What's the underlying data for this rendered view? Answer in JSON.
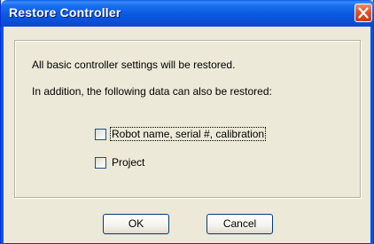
{
  "window": {
    "title": "Restore Controller"
  },
  "message": {
    "line1": "All basic controller settings will be restored.",
    "line2": "In addition, the following data can also be restored:"
  },
  "options": [
    {
      "label": "Robot name, serial #, calibration",
      "checked": false,
      "focused": true
    },
    {
      "label": "Project",
      "checked": false,
      "focused": false
    }
  ],
  "buttons": {
    "ok": "OK",
    "cancel": "Cancel"
  },
  "icons": {
    "close": "close-icon"
  },
  "colors": {
    "titlebar": "#0a58e0",
    "close_button": "#e0532c",
    "window_face": "#ece9d8"
  }
}
